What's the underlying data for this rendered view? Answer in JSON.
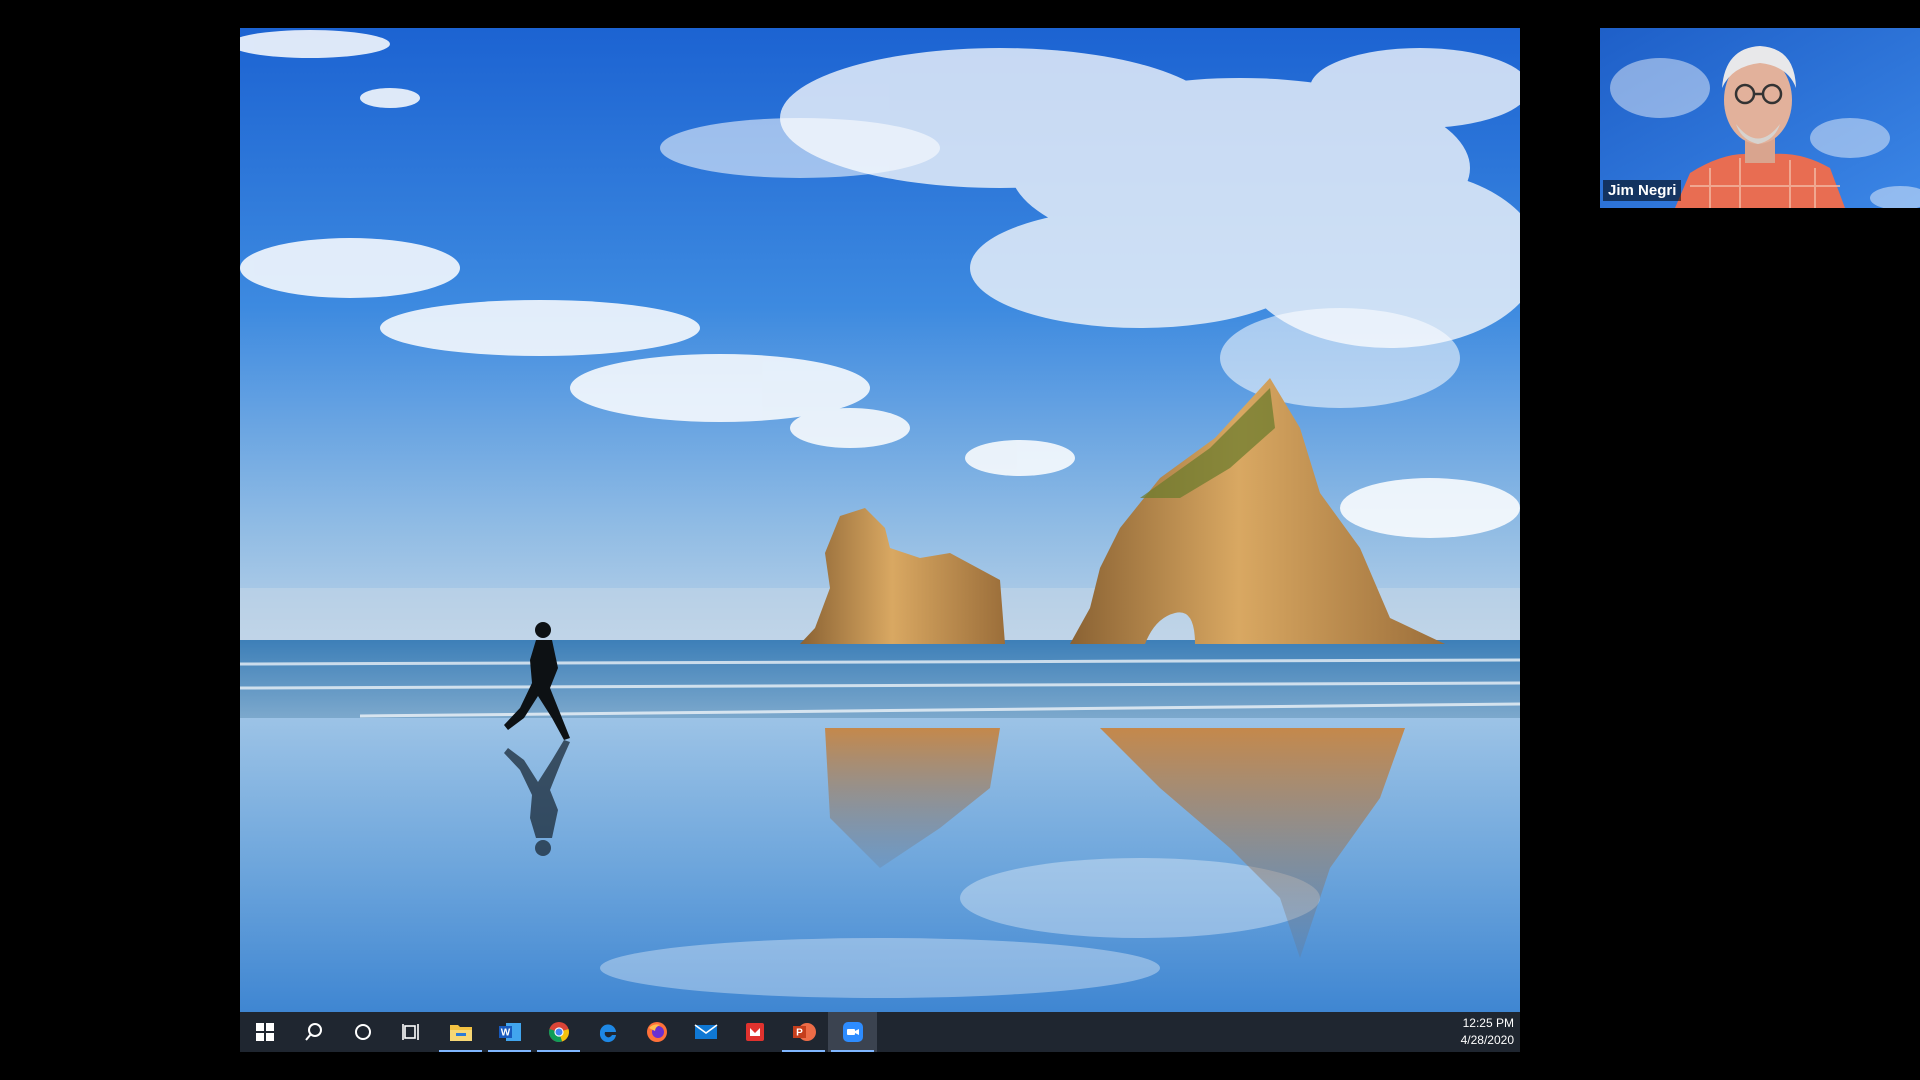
{
  "participant": {
    "name": "Jim Negri"
  },
  "taskbar": {
    "items": [
      {
        "id": "start",
        "icon": "windows-start-icon"
      },
      {
        "id": "search",
        "icon": "search-icon"
      },
      {
        "id": "cortana",
        "icon": "cortana-circle-icon"
      },
      {
        "id": "task-view",
        "icon": "task-view-icon"
      },
      {
        "id": "file-explorer",
        "icon": "file-explorer-icon",
        "running": true
      },
      {
        "id": "word",
        "icon": "word-icon",
        "running": true
      },
      {
        "id": "chrome",
        "icon": "chrome-icon",
        "running": true
      },
      {
        "id": "edge",
        "icon": "edge-icon"
      },
      {
        "id": "firefox",
        "icon": "firefox-icon"
      },
      {
        "id": "mail",
        "icon": "mail-icon"
      },
      {
        "id": "pdf-app",
        "icon": "red-app-icon"
      },
      {
        "id": "powerpoint",
        "icon": "powerpoint-icon",
        "running": true
      },
      {
        "id": "zoom",
        "icon": "zoom-icon",
        "running": true,
        "active": true
      }
    ],
    "clock": {
      "time": "12:25 PM",
      "date": "4/28/2020"
    }
  },
  "colors": {
    "taskbar": "#1f2630",
    "accent": "#7fb6ff",
    "sky_top": "#1e6ad6",
    "sky_horizon": "#a8c8e6",
    "rock": "#b58a4e"
  }
}
